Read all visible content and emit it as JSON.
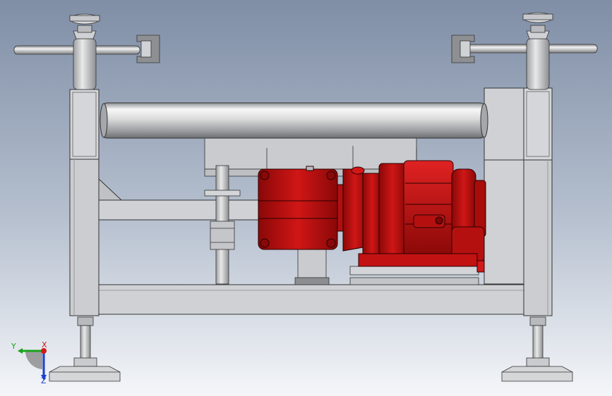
{
  "viewport": {
    "background": [
      "#7f8ea6",
      "#b6c0cf",
      "#f4f6f9"
    ],
    "frame_color": "#cfd1d4",
    "frame_shade": "#a9acb0",
    "motor_color": "#c81414",
    "motor_dark": "#8a0808",
    "motor_highlight": "#e53a3a",
    "outline_color": "#2a2a2a"
  },
  "triad": {
    "x_label": "X",
    "y_label": "Y",
    "z_label": "Z",
    "x_color": "#d11a1a",
    "y_color": "#1aa31a",
    "z_color": "#1a3fd1"
  }
}
